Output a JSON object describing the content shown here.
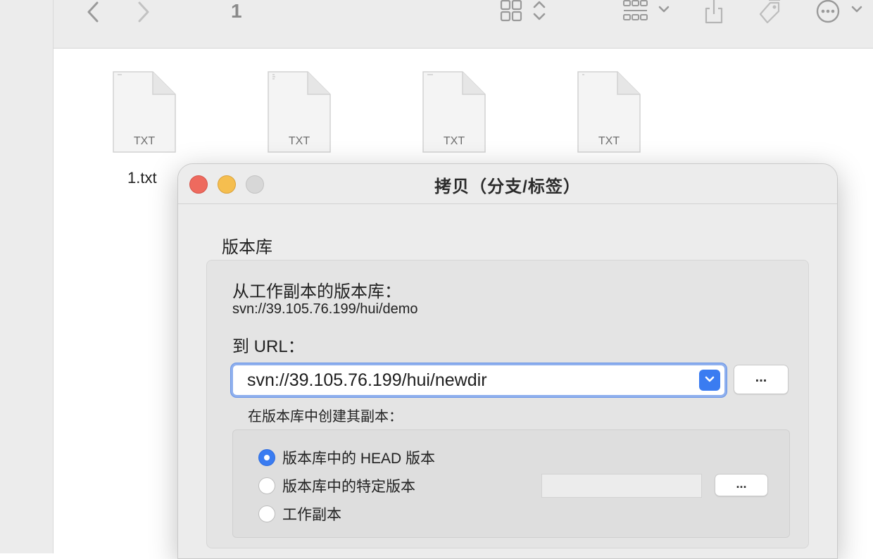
{
  "finder": {
    "folder_title": "1",
    "files": [
      {
        "ext": "TXT"
      },
      {
        "ext": "TXT"
      },
      {
        "ext": "TXT"
      },
      {
        "ext": "TXT"
      }
    ],
    "first_file_name": "1.txt"
  },
  "dialog": {
    "title": "拷贝（分支/标签）",
    "section_label": "版本库",
    "from_label": "从工作副本的版本库：",
    "from_url": "svn://39.105.76.199/hui/demo",
    "to_label": "到 URL：",
    "to_url": "svn://39.105.76.199/hui/newdir",
    "browse_label": "...",
    "create_label": "在版本库中创建其副本：",
    "options": [
      {
        "label": "版本库中的 HEAD 版本",
        "selected": true
      },
      {
        "label": "版本库中的特定版本",
        "selected": false
      },
      {
        "label": "工作副本",
        "selected": false
      }
    ],
    "revision_value": "",
    "revision_browse_label": "..."
  },
  "colors": {
    "accent": "#3a7cf1",
    "close": "#ee6a5e",
    "minimize": "#f5be4f",
    "zoom_disabled": "#d7d7d7"
  }
}
